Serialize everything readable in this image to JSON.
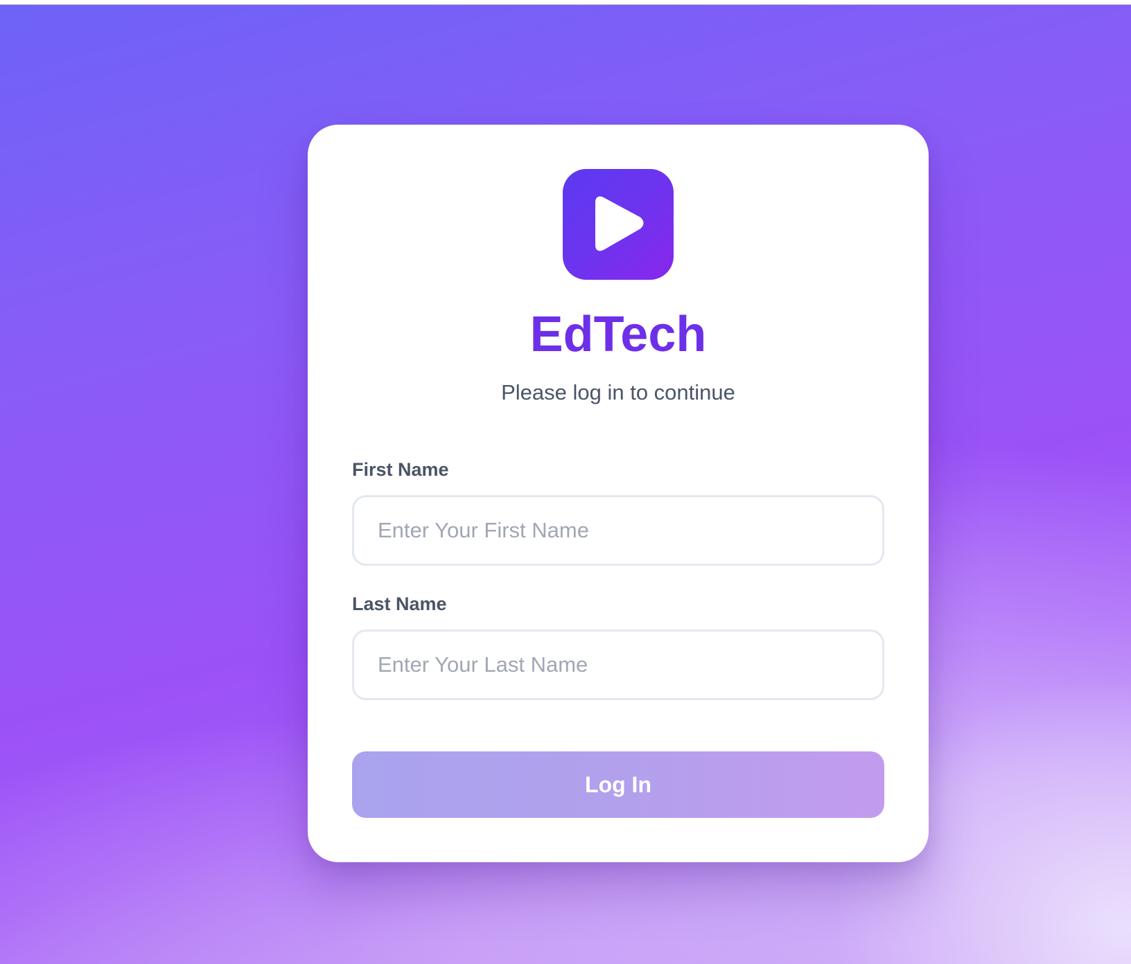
{
  "app": {
    "name": "EdTech",
    "subtitle": "Please log in to continue",
    "logo_icon": "play-icon"
  },
  "form": {
    "first_name": {
      "label": "First Name",
      "placeholder": "Enter Your First Name",
      "value": ""
    },
    "last_name": {
      "label": "Last Name",
      "placeholder": "Enter Your Last Name",
      "value": ""
    },
    "submit_label": "Log In"
  },
  "colors": {
    "brand": "#6d2fe8",
    "logo_gradient_start": "#5b3af0",
    "logo_gradient_end": "#8a26ec",
    "button_gradient_start": "#a9a3ee",
    "button_gradient_end": "#c39bee"
  }
}
